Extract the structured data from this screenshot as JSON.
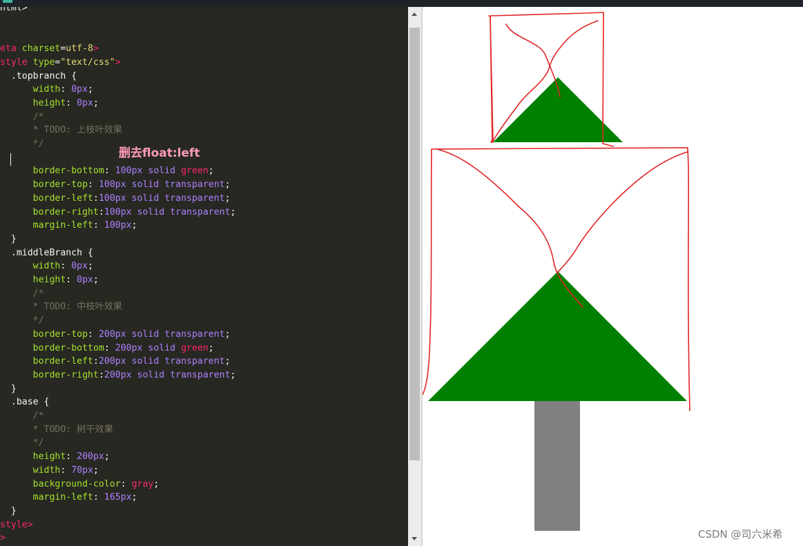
{
  "editor": {
    "annotation": "删去float:left",
    "lines": [
      [
        [
          "tk-pun",
          "html>"
        ]
      ],
      [],
      [],
      [
        [
          "tk-tag",
          "eta "
        ],
        [
          "tk-attr",
          "charset"
        ],
        [
          "tk-pun",
          "="
        ],
        [
          "tk-str",
          "utf-8"
        ],
        [
          "tk-tag",
          ">"
        ]
      ],
      [
        [
          "tk-tag",
          "style "
        ],
        [
          "tk-attr",
          "type"
        ],
        [
          "tk-pun",
          "="
        ],
        [
          "tk-str",
          "\"text/css\""
        ],
        [
          "tk-tag",
          ">"
        ]
      ],
      [
        [
          "tk-sel",
          "  .topbranch {"
        ]
      ],
      [
        [
          "tk-pun",
          "      "
        ],
        [
          "tk-prop",
          "width"
        ],
        [
          "tk-pun",
          ": "
        ],
        [
          "tk-num",
          "0px"
        ],
        [
          "tk-pun",
          ";"
        ]
      ],
      [
        [
          "tk-pun",
          "      "
        ],
        [
          "tk-prop",
          "height"
        ],
        [
          "tk-pun",
          ": "
        ],
        [
          "tk-num",
          "0px"
        ],
        [
          "tk-pun",
          ";"
        ]
      ],
      [
        [
          "tk-com",
          "      /*"
        ]
      ],
      [
        [
          "tk-com",
          "      * TODO: 上枝叶效果"
        ]
      ],
      [
        [
          "tk-com",
          "      */"
        ]
      ],
      [],
      [
        [
          "tk-pun",
          "      "
        ],
        [
          "tk-prop",
          "border-bottom"
        ],
        [
          "tk-pun",
          ": "
        ],
        [
          "tk-num",
          "100px"
        ],
        [
          "tk-pun",
          " "
        ],
        [
          "tk-kw",
          "solid"
        ],
        [
          "tk-pun",
          " "
        ],
        [
          "tk-red",
          "green"
        ],
        [
          "tk-pun",
          ";"
        ]
      ],
      [
        [
          "tk-pun",
          "      "
        ],
        [
          "tk-prop",
          "border-top"
        ],
        [
          "tk-pun",
          ": "
        ],
        [
          "tk-num",
          "100px"
        ],
        [
          "tk-pun",
          " "
        ],
        [
          "tk-kw",
          "solid"
        ],
        [
          "tk-pun",
          " "
        ],
        [
          "tk-kw",
          "transparent"
        ],
        [
          "tk-pun",
          ";"
        ]
      ],
      [
        [
          "tk-pun",
          "      "
        ],
        [
          "tk-prop",
          "border-left"
        ],
        [
          "tk-pun",
          ":"
        ],
        [
          "tk-num",
          "100px"
        ],
        [
          "tk-pun",
          " "
        ],
        [
          "tk-kw",
          "solid"
        ],
        [
          "tk-pun",
          " "
        ],
        [
          "tk-kw",
          "transparent"
        ],
        [
          "tk-pun",
          ";"
        ]
      ],
      [
        [
          "tk-pun",
          "      "
        ],
        [
          "tk-prop",
          "border-right"
        ],
        [
          "tk-pun",
          ":"
        ],
        [
          "tk-num",
          "100px"
        ],
        [
          "tk-pun",
          " "
        ],
        [
          "tk-kw",
          "solid"
        ],
        [
          "tk-pun",
          " "
        ],
        [
          "tk-kw",
          "transparent"
        ],
        [
          "tk-pun",
          ";"
        ]
      ],
      [
        [
          "tk-pun",
          "      "
        ],
        [
          "tk-prop",
          "margin-left"
        ],
        [
          "tk-pun",
          ": "
        ],
        [
          "tk-num",
          "100px"
        ],
        [
          "tk-pun",
          ";"
        ]
      ],
      [
        [
          "tk-sel",
          "  }"
        ]
      ],
      [
        [
          "tk-sel",
          "  .middleBranch {"
        ]
      ],
      [
        [
          "tk-pun",
          "      "
        ],
        [
          "tk-prop",
          "width"
        ],
        [
          "tk-pun",
          ": "
        ],
        [
          "tk-num",
          "0px"
        ],
        [
          "tk-pun",
          ";"
        ]
      ],
      [
        [
          "tk-pun",
          "      "
        ],
        [
          "tk-prop",
          "height"
        ],
        [
          "tk-pun",
          ": "
        ],
        [
          "tk-num",
          "0px"
        ],
        [
          "tk-pun",
          ";"
        ]
      ],
      [
        [
          "tk-com",
          "      /*"
        ]
      ],
      [
        [
          "tk-com",
          "      * TODO: 中枝叶效果"
        ]
      ],
      [
        [
          "tk-com",
          "      */"
        ]
      ],
      [
        [
          "tk-pun",
          "      "
        ],
        [
          "tk-prop",
          "border-top"
        ],
        [
          "tk-pun",
          ": "
        ],
        [
          "tk-num",
          "200px"
        ],
        [
          "tk-pun",
          " "
        ],
        [
          "tk-kw",
          "solid"
        ],
        [
          "tk-pun",
          " "
        ],
        [
          "tk-kw",
          "transparent"
        ],
        [
          "tk-pun",
          ";"
        ]
      ],
      [
        [
          "tk-pun",
          "      "
        ],
        [
          "tk-prop",
          "border-bottom"
        ],
        [
          "tk-pun",
          ": "
        ],
        [
          "tk-num",
          "200px"
        ],
        [
          "tk-pun",
          " "
        ],
        [
          "tk-kw",
          "solid"
        ],
        [
          "tk-pun",
          " "
        ],
        [
          "tk-red",
          "green"
        ],
        [
          "tk-pun",
          ";"
        ]
      ],
      [
        [
          "tk-pun",
          "      "
        ],
        [
          "tk-prop",
          "border-left"
        ],
        [
          "tk-pun",
          ":"
        ],
        [
          "tk-num",
          "200px"
        ],
        [
          "tk-pun",
          " "
        ],
        [
          "tk-kw",
          "solid"
        ],
        [
          "tk-pun",
          " "
        ],
        [
          "tk-kw",
          "transparent"
        ],
        [
          "tk-pun",
          ";"
        ]
      ],
      [
        [
          "tk-pun",
          "      "
        ],
        [
          "tk-prop",
          "border-right"
        ],
        [
          "tk-pun",
          ":"
        ],
        [
          "tk-num",
          "200px"
        ],
        [
          "tk-pun",
          " "
        ],
        [
          "tk-kw",
          "solid"
        ],
        [
          "tk-pun",
          " "
        ],
        [
          "tk-kw",
          "transparent"
        ],
        [
          "tk-pun",
          ";"
        ]
      ],
      [
        [
          "tk-sel",
          "  }"
        ]
      ],
      [
        [
          "tk-sel",
          "  .base {"
        ]
      ],
      [
        [
          "tk-com",
          "      /*"
        ]
      ],
      [
        [
          "tk-com",
          "      * TODO: 树干效果"
        ]
      ],
      [
        [
          "tk-com",
          "      */"
        ]
      ],
      [
        [
          "tk-pun",
          "      "
        ],
        [
          "tk-prop",
          "height"
        ],
        [
          "tk-pun",
          ": "
        ],
        [
          "tk-num",
          "200px"
        ],
        [
          "tk-pun",
          ";"
        ]
      ],
      [
        [
          "tk-pun",
          "      "
        ],
        [
          "tk-prop",
          "width"
        ],
        [
          "tk-pun",
          ": "
        ],
        [
          "tk-num",
          "70px"
        ],
        [
          "tk-pun",
          ";"
        ]
      ],
      [
        [
          "tk-pun",
          "      "
        ],
        [
          "tk-prop",
          "background-color"
        ],
        [
          "tk-pun",
          ": "
        ],
        [
          "tk-red",
          "gray"
        ],
        [
          "tk-pun",
          ";"
        ]
      ],
      [
        [
          "tk-pun",
          "      "
        ],
        [
          "tk-prop",
          "margin-left"
        ],
        [
          "tk-pun",
          ": "
        ],
        [
          "tk-num",
          "165px"
        ],
        [
          "tk-pun",
          ";"
        ]
      ],
      [
        [
          "tk-sel",
          "  }"
        ]
      ],
      [
        [
          "tk-tag",
          "style>"
        ]
      ],
      [
        [
          "tk-tag",
          ">"
        ]
      ]
    ]
  },
  "preview": {
    "watermark": "CSDN @司六米希",
    "colors": {
      "branch": "#008000",
      "trunk": "#808080",
      "markup": "#e02424"
    }
  }
}
